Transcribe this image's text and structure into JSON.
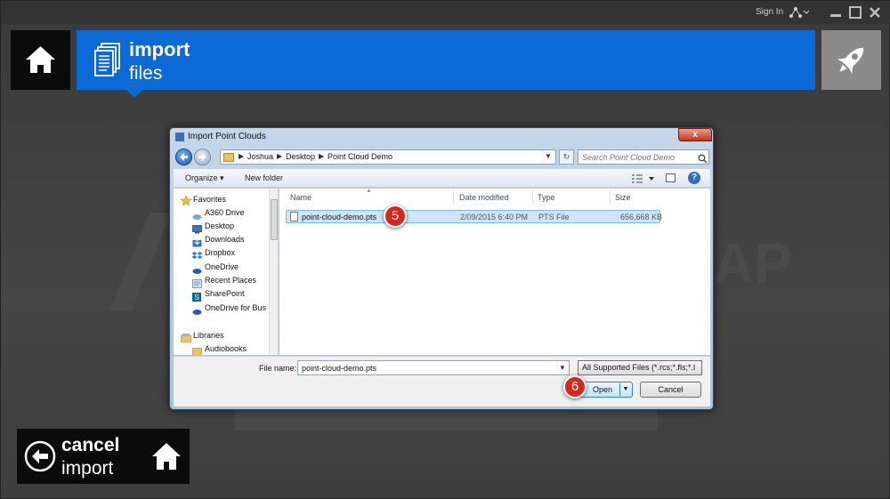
{
  "titlebar": {
    "signin": "Sign In"
  },
  "header": {
    "title": "import",
    "subtitle": "files"
  },
  "background": {
    "logo_fragment": "AP"
  },
  "cancel": {
    "title": "cancel",
    "subtitle": "import"
  },
  "dialog": {
    "title": "Import Point Clouds",
    "close_label": "x",
    "breadcrumb": [
      "Joshua",
      "Desktop",
      "Point Cloud Demo"
    ],
    "search_placeholder": "Search Point Cloud Demo",
    "toolbar": {
      "organize": "Organize ▾",
      "new_folder": "New folder"
    },
    "nav_pane": {
      "favorites_label": "Favorites",
      "items": [
        "A360 Drive",
        "Desktop",
        "Downloads",
        "Dropbox",
        "OneDrive",
        "Recent Places",
        "SharePoint",
        "OneDrive for Bus"
      ],
      "libraries_label": "Libraries",
      "libraries_items": [
        "Audiobooks"
      ]
    },
    "columns": [
      "Name",
      "Date modified",
      "Type",
      "Size"
    ],
    "files": [
      {
        "name": "point-cloud-demo.pts",
        "date": "2/09/2015 6:40 PM",
        "type": "PTS File",
        "size": "656,668 KB"
      }
    ],
    "file_name_label": "File name:",
    "file_name_value": "point-cloud-demo.pts",
    "file_type_value": "All Supported Files (*.rcs;*.fls;*.l",
    "open_label": "Open",
    "cancel_label": "Cancel"
  },
  "callouts": {
    "step5": "5",
    "step6": "6"
  },
  "colors": {
    "accent": "#0b6ad6",
    "callout": "#d8261c",
    "rocket_tile": "#8a8a8a"
  }
}
